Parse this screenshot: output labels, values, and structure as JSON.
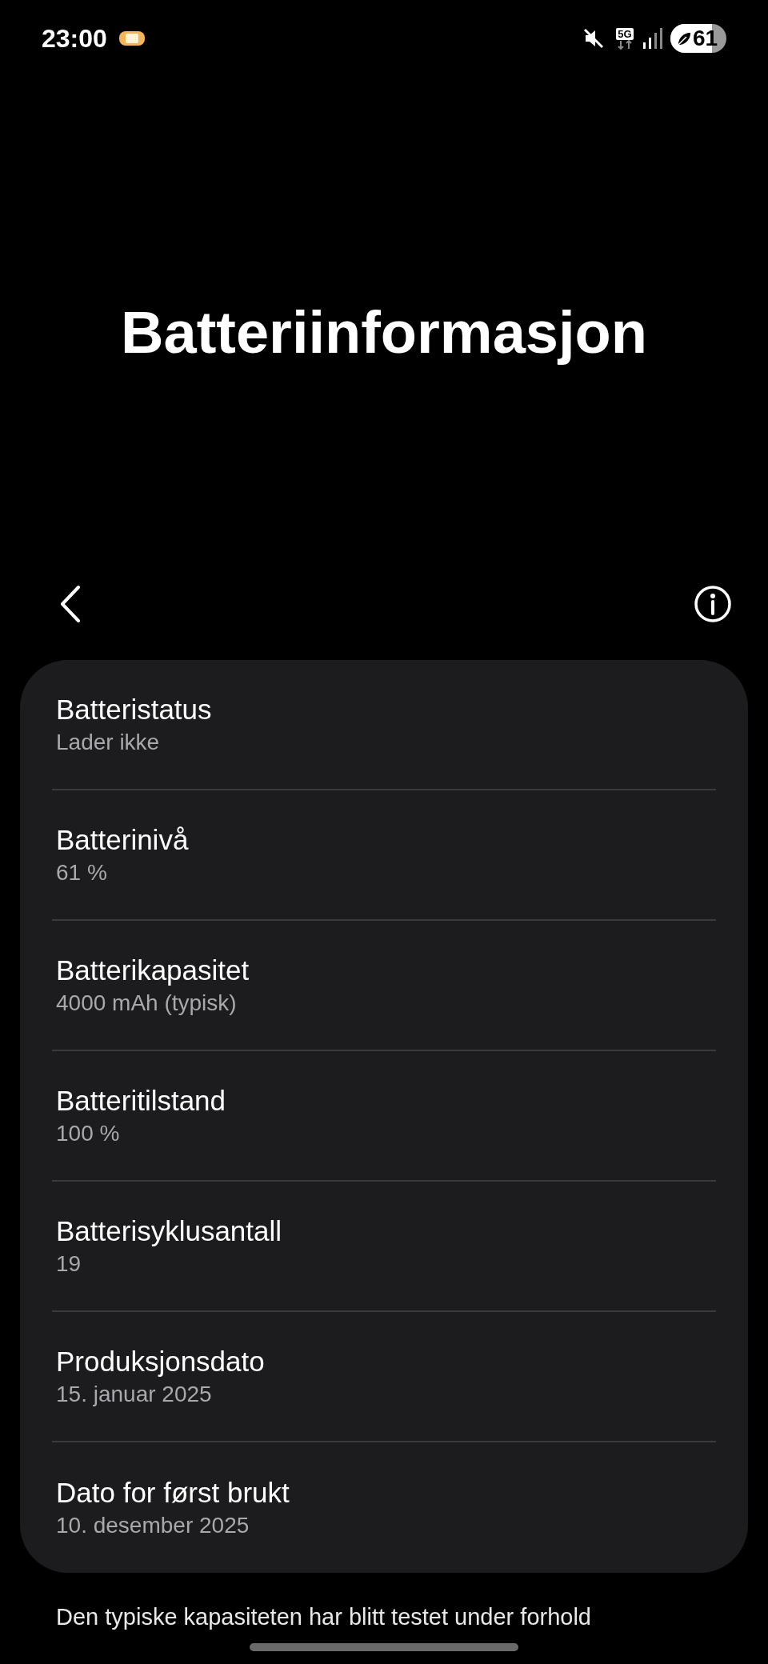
{
  "status_bar": {
    "time": "23:00",
    "network": "5G",
    "battery": "61"
  },
  "title": "Batteriinformasjon",
  "items": [
    {
      "label": "Batteristatus",
      "value": "Lader ikke"
    },
    {
      "label": "Batterinivå",
      "value": "61 %"
    },
    {
      "label": "Batterikapasitet",
      "value": "4000 mAh (typisk)"
    },
    {
      "label": "Batteritilstand",
      "value": "100 %"
    },
    {
      "label": "Batterisyklusantall",
      "value": "19"
    },
    {
      "label": "Produksjonsdato",
      "value": "15. januar 2025"
    },
    {
      "label": "Dato for først brukt",
      "value": "10. desember 2025"
    }
  ],
  "footer": "Den typiske kapasiteten har blitt testet under forhold"
}
